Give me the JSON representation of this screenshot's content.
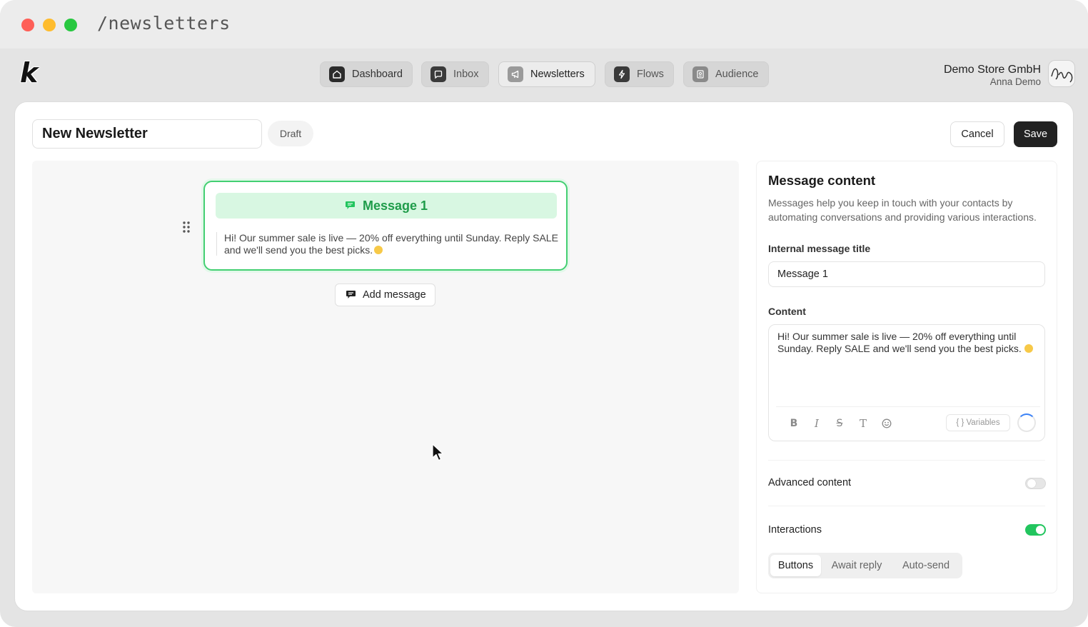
{
  "browser": {
    "url": "/newsletters"
  },
  "nav": {
    "items": [
      {
        "label": "Dashboard",
        "icon": "home-icon"
      },
      {
        "label": "Inbox",
        "icon": "chat-bubble-icon"
      },
      {
        "label": "Newsletters",
        "icon": "megaphone-icon",
        "active": true
      },
      {
        "label": "Flows",
        "icon": "lightning-icon"
      },
      {
        "label": "Audience",
        "icon": "contact-card-icon"
      }
    ]
  },
  "account": {
    "store": "Demo Store GmbH",
    "user": "Anna Demo"
  },
  "editor": {
    "title": "New Newsletter",
    "status": "Draft",
    "cancel_label": "Cancel",
    "save_label": "Save"
  },
  "canvas": {
    "message_title": "Message 1",
    "message_body": "Hi! Our summer sale is live — 20% off everything until Sunday. Reply SALE and we'll send you the best picks.",
    "add_message_label": "Add message"
  },
  "panel": {
    "title": "Message content",
    "description": "Messages help you keep in touch with your contacts by automating conversations and providing various interactions.",
    "internal_title_label": "Internal message title",
    "internal_title_value": "Message 1",
    "content_label": "Content",
    "content_value": "Hi! Our summer sale is live — 20% off everything until Sunday. Reply SALE and we'll send you the best picks.",
    "variables_label": "{ } Variables",
    "advanced_label": "Advanced content",
    "advanced_on": false,
    "interactions_label": "Interactions",
    "interactions_on": true,
    "interaction_tabs": [
      "Buttons",
      "Await reply",
      "Auto-send"
    ],
    "interaction_active": "Buttons"
  },
  "colors": {
    "accent_green": "#22c55e",
    "node_border": "#43cf72",
    "save_bg": "#222222"
  }
}
